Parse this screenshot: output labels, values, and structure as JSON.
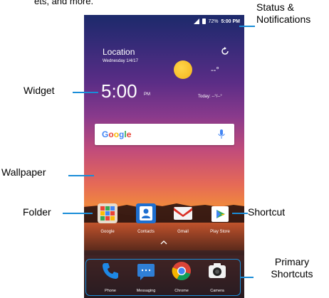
{
  "intro_text_clip": "ets, and more.",
  "callouts": {
    "status": "Status &\nNotifications",
    "status_line1": "Status &",
    "status_line2": "Notifications",
    "widget": "Widget",
    "wallpaper": "Wallpaper",
    "folder": "Folder",
    "shortcut": "Shortcut",
    "primary_line1": "Primary",
    "primary_line2": "Shortcuts"
  },
  "status_bar": {
    "battery": "72%",
    "time": "5:00 PM"
  },
  "weather_widget": {
    "location": "Location",
    "date": "Wednesday 1/4/17",
    "temp": "--°",
    "clock": "5:00",
    "ampm": "PM",
    "today": "Today: --°/--°"
  },
  "search_bar": {
    "brand": "Google"
  },
  "home_apps": [
    {
      "label": "Google",
      "icon": "folder-icon"
    },
    {
      "label": "Contacts",
      "icon": "contacts-icon"
    },
    {
      "label": "Gmail",
      "icon": "gmail-icon"
    },
    {
      "label": "Play Store",
      "icon": "play-store-icon"
    }
  ],
  "dock_apps": [
    {
      "label": "Phone",
      "icon": "phone-icon"
    },
    {
      "label": "Messaging",
      "icon": "messaging-icon"
    },
    {
      "label": "Chrome",
      "icon": "chrome-icon"
    },
    {
      "label": "Camera",
      "icon": "camera-icon"
    }
  ],
  "colors": {
    "callout_line": "#1a8dd8",
    "sun": "#f5b41c"
  }
}
